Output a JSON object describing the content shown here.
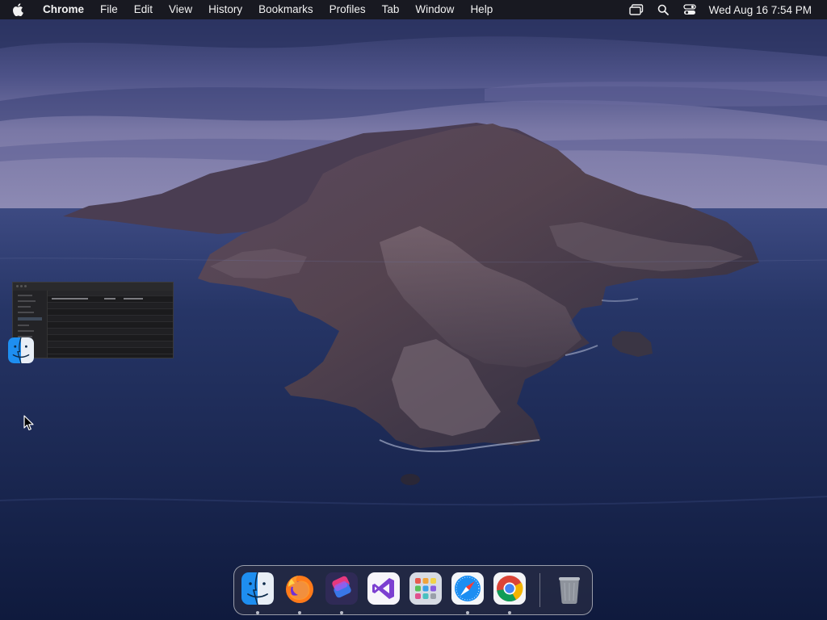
{
  "menubar": {
    "apple_icon": "apple-logo-icon",
    "app_name": "Chrome",
    "menus": [
      "File",
      "Edit",
      "View",
      "History",
      "Bookmarks",
      "Profiles",
      "Tab",
      "Window",
      "Help"
    ],
    "status_icons": [
      "screen-mirroring-icon",
      "spotlight-search-icon",
      "control-center-icon"
    ],
    "clock": "Wed Aug 16  7:54 PM"
  },
  "desktop": {
    "wallpaper": "macOS Catalina island at dusk",
    "desktop_icons": [
      {
        "icon": "finder-icon"
      }
    ],
    "window_thumbnail": {
      "app": "Finder",
      "state": "minimized preview"
    }
  },
  "dock": {
    "apps": [
      {
        "name": "Finder",
        "icon": "finder-icon",
        "running": true
      },
      {
        "name": "Firefox",
        "icon": "firefox-icon",
        "running": true
      },
      {
        "name": "Shortcuts",
        "icon": "shortcuts-icon",
        "running": true
      },
      {
        "name": "Visual Studio",
        "icon": "visual-studio-icon",
        "running": false
      },
      {
        "name": "Launchpad",
        "icon": "launchpad-icon",
        "running": false
      },
      {
        "name": "Safari",
        "icon": "safari-icon",
        "running": true
      },
      {
        "name": "Google Chrome",
        "icon": "chrome-icon",
        "running": true
      }
    ],
    "trash": {
      "name": "Trash",
      "icon": "trash-icon"
    }
  },
  "colors": {
    "menubar_bg": "#18181e",
    "menubar_text": "#f2f2f2",
    "sky_top": "#2d3566",
    "sea": "#17244d"
  }
}
